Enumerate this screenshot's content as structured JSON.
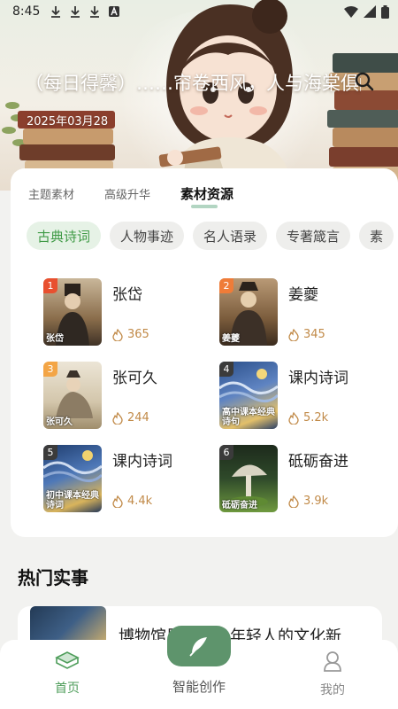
{
  "status_bar": {
    "time": "8:45",
    "notification_icons": [
      "download-icon",
      "download-icon",
      "download-icon",
      "text-app-icon"
    ],
    "right_icons": [
      "wifi-icon",
      "signal-icon",
      "battery-icon"
    ]
  },
  "hero": {
    "text": "（每日得馨）……帘卷西风，人与海棠俱醉",
    "date": "2025年03月28",
    "search_icon": "search-icon"
  },
  "tabs": [
    {
      "label": "主题素材",
      "active": false
    },
    {
      "label": "高级升华",
      "active": false
    },
    {
      "label": "素材资源",
      "active": true
    }
  ],
  "chips": [
    {
      "label": "古典诗词",
      "active": true
    },
    {
      "label": "人物事迹",
      "active": false
    },
    {
      "label": "名人语录",
      "active": false
    },
    {
      "label": "专著箴言",
      "active": false
    },
    {
      "label": "素",
      "active": false
    }
  ],
  "items": [
    {
      "rank": "1",
      "name": "张岱",
      "heat": "365",
      "caption": "张岱",
      "rank_color": "#e8502f"
    },
    {
      "rank": "2",
      "name": "姜夔",
      "heat": "345",
      "caption": "姜夔",
      "rank_color": "#ef7c38"
    },
    {
      "rank": "3",
      "name": "张可久",
      "heat": "244",
      "caption": "张可久",
      "rank_color": "#f3a546"
    },
    {
      "rank": "4",
      "name": "课内诗词",
      "heat": "5.2k",
      "caption": "高中课本经典诗句",
      "rank_color": "#3b3b3b"
    },
    {
      "rank": "5",
      "name": "课内诗词",
      "heat": "4.4k",
      "caption": "初中课本经典诗词",
      "rank_color": "#3b3b3b"
    },
    {
      "rank": "6",
      "name": "砥砺奋进",
      "heat": "3.9k",
      "caption": "砥砺奋进",
      "rank_color": "#3b3b3b"
    }
  ],
  "hot_section": {
    "title": "热门实事",
    "article_title": "博物馆里的……年轻人的文化新"
  },
  "bottom_nav": {
    "home": "首页",
    "create": "智能创作",
    "mine": "我的"
  },
  "colors": {
    "accent_green": "#4f9e5b",
    "fab_green": "#5e946c",
    "heat_color": "#c18a48"
  }
}
